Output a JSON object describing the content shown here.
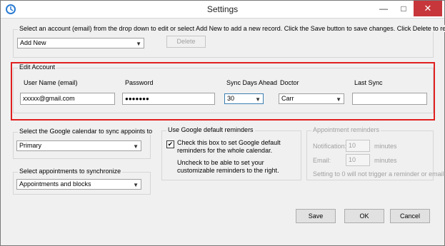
{
  "window": {
    "title": "Settings",
    "minimize": "—",
    "maximize": "□",
    "close": "✕"
  },
  "account_select": {
    "instruction": "Select an account (email) from the drop down to edit or select Add New to add a new record.  Click the Save button to save changes. Click Delete to remove.",
    "value": "Add New",
    "delete_label": "Delete"
  },
  "edit_account": {
    "legend": "Edit Account",
    "labels": {
      "username": "User Name (email)",
      "password": "Password",
      "sync_days": "Sync Days Ahead",
      "doctor": "Doctor",
      "last_sync": "Last Sync"
    },
    "values": {
      "username": "xxxxx@gmail.com",
      "password": "●●●●●●●",
      "sync_days": "30",
      "doctor": "Carr",
      "last_sync": ""
    }
  },
  "calendar": {
    "legend": "Select the Google calendar to sync appoints to",
    "value": "Primary"
  },
  "appointments": {
    "legend": "Select appointments to synchronize",
    "value": "Appointments and blocks"
  },
  "google_default": {
    "legend": "Use Google default reminders",
    "checkbox_text": "Check this box to set Google default reminders for the whole calendar.",
    "uncheck_text": "Uncheck to be able to set your customizable reminders to the right.",
    "checked": true,
    "check_mark": "✔"
  },
  "reminders": {
    "legend": "Appointment reminders",
    "notification_label": "Notification:",
    "notification_value": "10",
    "email_label": "Email:",
    "email_value": "10",
    "unit": "minutes",
    "note": "Setting to 0 will not trigger a reminder or email"
  },
  "buttons": {
    "save": "Save",
    "ok": "OK",
    "cancel": "Cancel"
  },
  "icons": {
    "dropdown": "▼"
  }
}
